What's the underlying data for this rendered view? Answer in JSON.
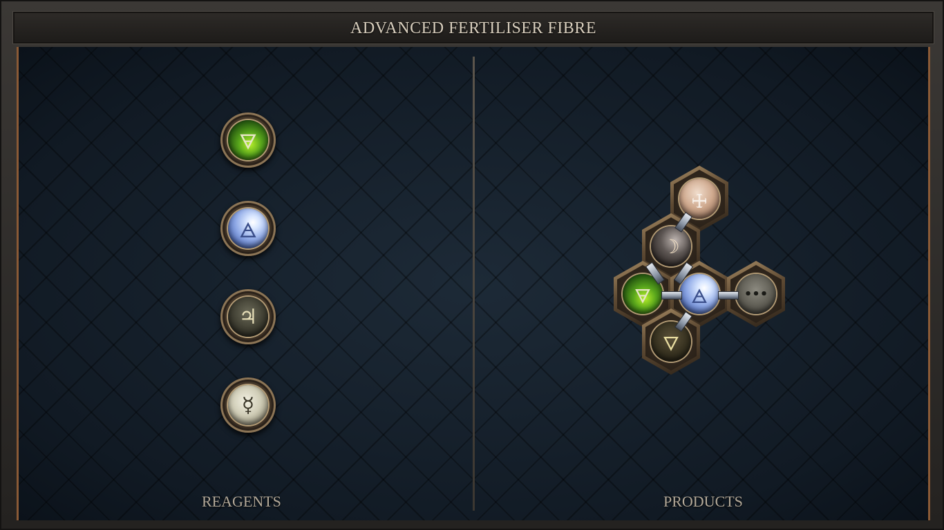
{
  "window": {
    "title": "ADVANCED FERTILISER FIBRE"
  },
  "reagents": {
    "label": "REAGENTS",
    "items": [
      {
        "symbol": "🜃",
        "element": "earth",
        "color": "green"
      },
      {
        "symbol": "🜁",
        "element": "air",
        "color": "blue"
      },
      {
        "symbol": "♃",
        "element": "jupiter",
        "color": "dark"
      },
      {
        "symbol": "☿",
        "element": "mercury",
        "color": "pale"
      }
    ]
  },
  "products": {
    "label": "PRODUCTS",
    "items": [
      {
        "symbol": "🜊",
        "element": "copper-symbol",
        "color": "copper"
      },
      {
        "symbol": "☽",
        "element": "moon",
        "color": "moon"
      },
      {
        "symbol": "🜃",
        "element": "earth",
        "color": "green"
      },
      {
        "symbol": "🜁",
        "element": "air",
        "color": "blue"
      },
      {
        "symbol": "•••",
        "element": "more",
        "color": "grey"
      },
      {
        "symbol": "🜄",
        "element": "water-earth",
        "color": "earth"
      }
    ]
  },
  "colors": {
    "frame": "#2a2826",
    "board": "#15202c",
    "accent": "#8a5a36",
    "title_text": "#d9cfbe",
    "label_text": "#b4aa9a"
  }
}
